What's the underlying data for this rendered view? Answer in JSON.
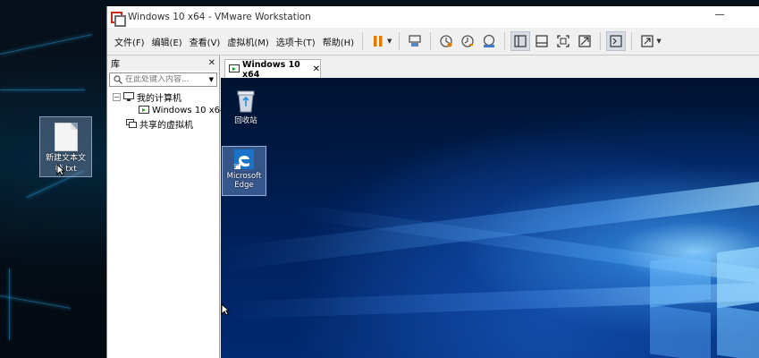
{
  "host": {
    "desktop_file_label": "新建文本文档.txt",
    "desktop_file_icon": "text-file-icon"
  },
  "window": {
    "title": "Windows 10 x64 - VMware Workstation",
    "app_icon": "vmware-icon"
  },
  "menu": {
    "file": "文件(F)",
    "edit": "编辑(E)",
    "view": "查看(V)",
    "vm": "虚拟机(M)",
    "tabs": "选项卡(T)",
    "help": "帮助(H)"
  },
  "toolbar": {
    "icons": [
      "pause-icon",
      "send-ctrl-alt-del-icon",
      "snapshot-icon",
      "revert-snapshot-icon",
      "snapshot-manager-icon",
      "library-view-icon",
      "thumbnail-view-icon",
      "fullscreen-icon",
      "unity-icon",
      "console-view-icon",
      "stretch-icon"
    ],
    "accent_color": "#e07b00"
  },
  "library": {
    "title": "库",
    "search_placeholder": "在此处键入内容...",
    "tree": {
      "my_computer": "我的计算机",
      "vm_item": "Windows 10 x64",
      "shared_vms": "共享的虚拟机"
    }
  },
  "tab": {
    "label": "Windows 10 x64"
  },
  "guest": {
    "recycle_bin_label": "回收站",
    "edge_label_line1": "Microsoft",
    "edge_label_line2": "Edge",
    "wallpaper_color": "#0a4fb0"
  }
}
